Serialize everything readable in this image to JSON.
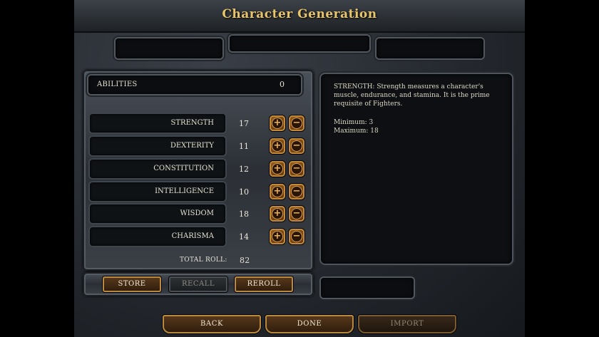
{
  "title": "Character Generation",
  "abilities": {
    "header_label": "ABILITIES",
    "points_remaining": "0",
    "rows": [
      {
        "name": "STRENGTH",
        "value": "17"
      },
      {
        "name": "DEXTERITY",
        "value": "11"
      },
      {
        "name": "CONSTITUTION",
        "value": "12"
      },
      {
        "name": "INTELLIGENCE",
        "value": "10"
      },
      {
        "name": "WISDOM",
        "value": "18"
      },
      {
        "name": "CHARISMA",
        "value": "14"
      }
    ],
    "total_label": "TOTAL ROLL:",
    "total_value": "82",
    "plus_glyph": "+",
    "minus_glyph": "−"
  },
  "roll_buttons": {
    "store": "STORE",
    "recall": "RECALL",
    "reroll": "REROLL"
  },
  "description": {
    "text": "STRENGTH: Strength measures a character's muscle, endurance, and stamina. It is the prime requisite of Fighters.",
    "minimum": "Minimum: 3",
    "maximum": "Maximum: 18"
  },
  "footer": {
    "back": "BACK",
    "done": "DONE",
    "import": "IMPORT"
  },
  "colors": {
    "title": "#e8c46a",
    "button_border": "#b98a3e",
    "text": "#e7e2d2"
  }
}
